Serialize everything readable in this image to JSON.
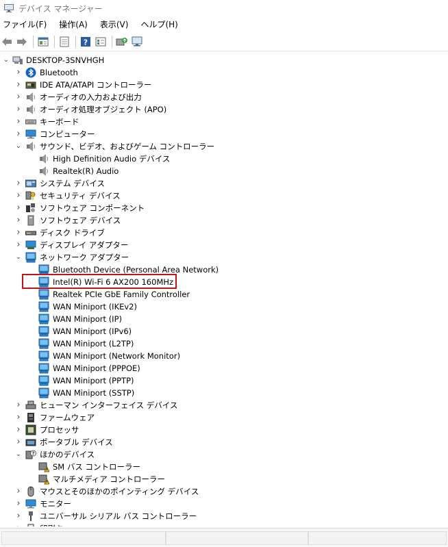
{
  "window": {
    "title": "デバイス マネージャー"
  },
  "menu": [
    "ファイル(F)",
    "操作(A)",
    "表示(V)",
    "ヘルプ(H)"
  ],
  "toolbar_icons": [
    "back-arrow-icon",
    "forward-arrow-icon",
    "properties-icon",
    "help-icon",
    "show-hidden-icon",
    "update-driver-icon",
    "scan-hardware-icon"
  ],
  "tree": {
    "root": "DESKTOP-3SNVHGH",
    "rows": [
      {
        "label": "Bluetooth",
        "level": 1,
        "expand": "collapsed",
        "icon": "bluetooth-icon"
      },
      {
        "label": "IDE ATA/ATAPI コントローラー",
        "level": 1,
        "expand": "collapsed",
        "icon": "ide-controller-icon"
      },
      {
        "label": "オーディオの入力および出力",
        "level": 1,
        "expand": "collapsed",
        "icon": "speaker-icon"
      },
      {
        "label": "オーディオ処理オブジェクト (APO)",
        "level": 1,
        "expand": "collapsed",
        "icon": "speaker-icon"
      },
      {
        "label": "キーボード",
        "level": 1,
        "expand": "collapsed",
        "icon": "keyboard-icon"
      },
      {
        "label": "コンピューター",
        "level": 1,
        "expand": "collapsed",
        "icon": "computer-icon"
      },
      {
        "label": "サウンド、ビデオ、およびゲーム コントローラー",
        "level": 1,
        "expand": "expanded",
        "icon": "speaker-icon"
      },
      {
        "label": "High Definition Audio デバイス",
        "level": 2,
        "expand": "none",
        "icon": "speaker-icon"
      },
      {
        "label": "Realtek(R) Audio",
        "level": 2,
        "expand": "none",
        "icon": "speaker-icon"
      },
      {
        "label": "システム デバイス",
        "level": 1,
        "expand": "collapsed",
        "icon": "system-device-icon"
      },
      {
        "label": "セキュリティ デバイス",
        "level": 1,
        "expand": "collapsed",
        "icon": "security-key-icon"
      },
      {
        "label": "ソフトウェア コンポーネント",
        "level": 1,
        "expand": "collapsed",
        "icon": "software-component-icon"
      },
      {
        "label": "ソフトウェア デバイス",
        "level": 1,
        "expand": "collapsed",
        "icon": "software-device-icon"
      },
      {
        "label": "ディスク ドライブ",
        "level": 1,
        "expand": "collapsed",
        "icon": "disk-drive-icon"
      },
      {
        "label": "ディスプレイ アダプター",
        "level": 1,
        "expand": "collapsed",
        "icon": "display-adapter-icon"
      },
      {
        "label": "ネットワーク アダプター",
        "level": 1,
        "expand": "expanded",
        "icon": "network-adapter-icon"
      },
      {
        "label": "Bluetooth Device (Personal Area Network)",
        "level": 2,
        "expand": "none",
        "icon": "network-adapter-icon"
      },
      {
        "label": "Intel(R) Wi-Fi 6 AX200 160MHz",
        "level": 2,
        "expand": "none",
        "icon": "network-adapter-icon",
        "highlighted": true
      },
      {
        "label": "Realtek PCIe GbE Family Controller",
        "level": 2,
        "expand": "none",
        "icon": "network-adapter-icon"
      },
      {
        "label": "WAN Miniport (IKEv2)",
        "level": 2,
        "expand": "none",
        "icon": "network-adapter-icon"
      },
      {
        "label": "WAN Miniport (IP)",
        "level": 2,
        "expand": "none",
        "icon": "network-adapter-icon"
      },
      {
        "label": "WAN Miniport (IPv6)",
        "level": 2,
        "expand": "none",
        "icon": "network-adapter-icon"
      },
      {
        "label": "WAN Miniport (L2TP)",
        "level": 2,
        "expand": "none",
        "icon": "network-adapter-icon"
      },
      {
        "label": "WAN Miniport (Network Monitor)",
        "level": 2,
        "expand": "none",
        "icon": "network-adapter-icon"
      },
      {
        "label": "WAN Miniport (PPPOE)",
        "level": 2,
        "expand": "none",
        "icon": "network-adapter-icon"
      },
      {
        "label": "WAN Miniport (PPTP)",
        "level": 2,
        "expand": "none",
        "icon": "network-adapter-icon"
      },
      {
        "label": "WAN Miniport (SSTP)",
        "level": 2,
        "expand": "none",
        "icon": "network-adapter-icon"
      },
      {
        "label": "ヒューマン インターフェイス デバイス",
        "level": 1,
        "expand": "collapsed",
        "icon": "hid-icon"
      },
      {
        "label": "ファームウェア",
        "level": 1,
        "expand": "collapsed",
        "icon": "firmware-icon"
      },
      {
        "label": "プロセッサ",
        "level": 1,
        "expand": "collapsed",
        "icon": "processor-icon"
      },
      {
        "label": "ポータブル デバイス",
        "level": 1,
        "expand": "collapsed",
        "icon": "portable-device-icon"
      },
      {
        "label": "ほかのデバイス",
        "level": 1,
        "expand": "expanded",
        "icon": "unknown-device-icon"
      },
      {
        "label": "SM バス コントローラー",
        "level": 2,
        "expand": "none",
        "icon": "warning-device-icon"
      },
      {
        "label": "マルチメディア コントローラー",
        "level": 2,
        "expand": "none",
        "icon": "warning-device-icon"
      },
      {
        "label": "マウスとそのほかのポインティング デバイス",
        "level": 1,
        "expand": "collapsed",
        "icon": "mouse-icon"
      },
      {
        "label": "モニター",
        "level": 1,
        "expand": "collapsed",
        "icon": "monitor-icon"
      },
      {
        "label": "ユニバーサル シリアル バス コントローラー",
        "level": 1,
        "expand": "collapsed",
        "icon": "usb-icon"
      },
      {
        "label": "印刷キュー",
        "level": 1,
        "expand": "collapsed",
        "icon": "printer-icon"
      }
    ]
  },
  "colors": {
    "highlight_border": "#c0141c",
    "network_blue": "#1e78c8"
  }
}
